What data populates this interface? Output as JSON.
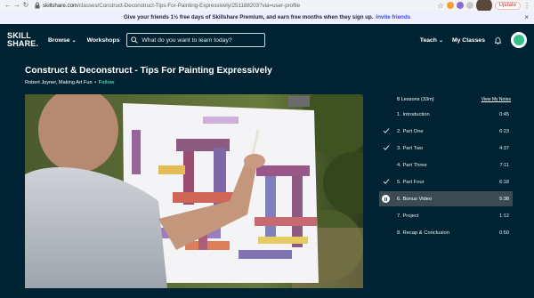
{
  "browser": {
    "url_host": "skillshare.com",
    "url_path": "/classes/Construct-Deconstruct-Tips-For-Painting-Expressively/251188203?via=user-profile",
    "update_label": "Update"
  },
  "promo": {
    "text": "Give your friends 1½ free days of Skillshare Premium, and earn free months when they sign up.",
    "link": "Invite friends"
  },
  "nav": {
    "logo_line1": "SKILL",
    "logo_line2": "SHARE.",
    "browse": "Browse",
    "workshops": "Workshops",
    "search_placeholder": "What do you want to learn today?",
    "teach": "Teach",
    "my_classes": "My Classes"
  },
  "course": {
    "title": "Construct & Deconstruct - Tips For Painting Expressively",
    "author": "Robert Joyner, Making Art Fun",
    "separator": "•",
    "follow": "Follow"
  },
  "lessons": {
    "count_label": "8 Lessons (33m)",
    "view_notes": "View My Notes",
    "items": [
      {
        "label": "1. Introduction",
        "time": "0:45",
        "status": "none"
      },
      {
        "label": "2. Part One",
        "time": "6:23",
        "status": "done"
      },
      {
        "label": "3. Part Two",
        "time": "4:37",
        "status": "done"
      },
      {
        "label": "4. Part Three",
        "time": "7:11",
        "status": "none"
      },
      {
        "label": "5. Part Four",
        "time": "6:18",
        "status": "done"
      },
      {
        "label": "6. Bonus Video",
        "time": "5:38",
        "status": "playing"
      },
      {
        "label": "7. Project",
        "time": "1:12",
        "status": "none"
      },
      {
        "label": "8. Recap & Conclusion",
        "time": "0:50",
        "status": "none"
      }
    ]
  },
  "colors": {
    "background": "#002333",
    "follow_green": "#36d6a0",
    "invite_blue": "#3a4cf0",
    "active_row": "#3c4a52"
  }
}
